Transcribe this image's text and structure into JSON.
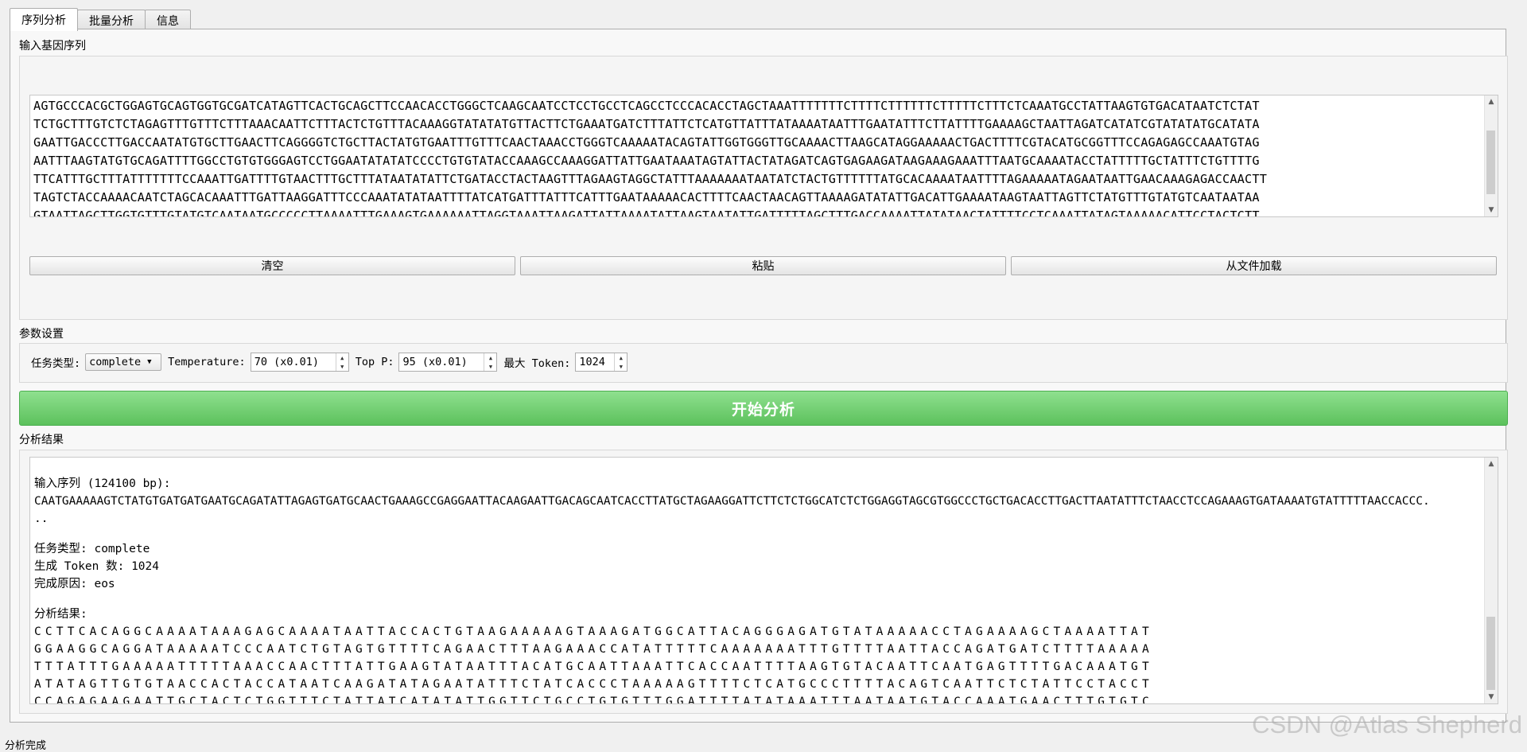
{
  "tabs": [
    "序列分析",
    "批量分析",
    "信息"
  ],
  "input_section": {
    "label": "输入基因序列",
    "sequence_lines": [
      "AGTGCCCACGCTGGAGTGCAGTGGTGCGATCATAGTTCACTGCAGCTTCCAACACCTGGGCTCAAGCAATCCTCCTGCCTCAGCCTCCCACACCTAGCTAAATTTTTTTCTTTTCTTTTTTCTTTTTCTTTCTCAAATGCCTATTAAGTGTGACATAATCTCTAT",
      "TCTGCTTTGTCTCTAGAGTTTGTTTCTTTAAACAATTCTTTACTCTGTTTACAAAGGTATATATGTTACTTCTGAAATGATCTTTATTCTCATGTTATTTATAAAATAATTTGAATATTTCTTATTTTGAAAAGCTAATTAGATCATATCGTATATATGCATATA",
      "GAATTGACCCTTGACCAATATGTGCTTGAACTTCAGGGGTCTGCTTACTATGTGAATTTGTTTCAACTAAACCTGGGTCAAAAATACAGTATTGGTGGGTTGCAAAACTTAAGCATAGGAAAAACTGACTTTTCGTACATGCGGTTTCCAGAGAGCCAAATGTAG",
      "AATTTAAGTATGTGCAGATTTTGGCCTGTGTGGGAGTCCTGGAATATATATCCCCTGTGTATACCAAAGCCAAAGGATTATTGAATAAATAGTATTACTATAGATCAGTGAGAAGATAAGAAAGAAATTTAATGCAAAATACCTATTTTTGCTATTTCTGTTTTG",
      "TTCATTTGCTTTATTTTTTTCCAAATTGATTTTGTAACTTTGCTTTATAATATATTCTGATACCTACTAAGTTTAGAAGTAGGCTATTTAAAAAAATAATATCTACTGTTTTTTATGCACAAAATAATTTTAGAAAAATAGAATAATTGAACAAAGAGACCAACTT",
      "TAGTCTACCAAAACAATCTAGCACAAATTTGATTAAGGATTTCCCAAATATATAATTTTATCATGATTTATTTCATTTGAATAAAAACACTTTTCAACTAACAGTTAAAAGATATATTGACATTGAAAATAAGTAATTAGTTCTATGTTTGTATGTCAATAATAA",
      "GTAATTAGCTTGGTGTTTGTATGTCAATAATGCCCCCTTAAAATTTGAAAGTGAAAAAATTAGGTAAATTAAGATTATTAAAATATTAAGTAATATTGATTTTTAGCTTTGACCAAAATTATATAACTATTTTCCTCAAATTATAGTAAAAACATTCCTACTCTT"
    ],
    "buttons": {
      "clear": "清空",
      "paste": "粘贴",
      "load": "从文件加载"
    }
  },
  "params": {
    "label": "参数设置",
    "task_type_label": "任务类型:",
    "task_type_value": "complete",
    "temperature_label": "Temperature:",
    "temperature_value": "70 (x0.01)",
    "top_p_label": "Top P:",
    "top_p_value": "95 (x0.01)",
    "max_token_label": "最大 Token:",
    "max_token_value": "1024"
  },
  "start_button": "开始分析",
  "results": {
    "label": "分析结果",
    "input_header": "输入序列 (124100 bp):",
    "input_seq": "CAATGAAAAAGTCTATGTGATGATGAATGCAGATATTAGAGTGATGCAACTGAAAGCCGAGGAATTACAAGAATTGACAGCAATCACCTTATGCTAGAAGGATTCTTCTCTGGCATCTCTGGAGGTAGCGTGGCCCTGCTGACACCTTGACTTAATATTTCTAACCTCCAGAAAGTGATAAAATGTATTTTTAACCACCC.",
    "input_seq_cont": "..",
    "task_line": "任务类型: complete",
    "tokens_line": "生成 Token 数: 1024",
    "reason_line": "完成原因: eos",
    "analysis_header": "分析结果:",
    "output_lines": [
      "CCTTCACAGGCAAAATAAAGAGCAAAATAATTACCACTGTAAGAAAAAGTAAAGATGGCATTACAGGGAGATGTATAAAAACCTAGAAAAGCTAAAATTAT",
      "GGAAGGCAGGATAAAAATCCCAATCTGTAGTGTTTTCAGAACTTTAAGAAACCATATTTTTCAAAAAAATTTGTTTTAATTACCAGATGATCTTTTAAAAA",
      "TTTATTTGAAAAATTTTTAAACCAACTTTATTGAAGTATAATTTACATGCAATTAAATTCACCAATTTTAAGTGTACAATTCAATGAGTTTTGACAAATGT",
      "ATATAGTTGTGTAACCACTACCATAATCAAGATATAGAATATTTCTATCACCCTAAAAAGTTTTCTCATGCCCTTTTACAGTCAATTCTCTATTCCTACCT",
      "CCAGAGAAGAATTGCTACTCTGGTTTCTATTATCATATATTGGTTCTGCCTGTGTTTGGATTTTATATAAATTTAATAATGTACCAAATGAACTTTGTGTC"
    ]
  },
  "status_text": "分析完成",
  "watermark": "CSDN @Atlas Shepherd",
  "colors": {
    "accent": "#5cc15c"
  }
}
